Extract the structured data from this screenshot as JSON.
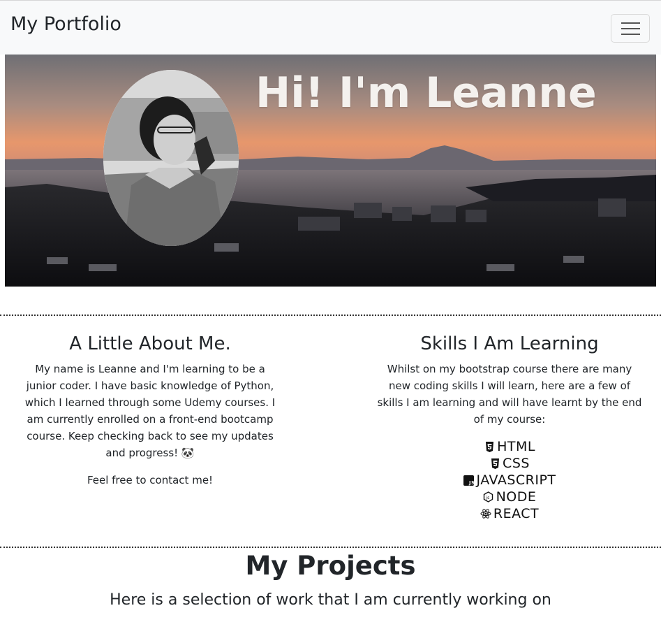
{
  "nav": {
    "brand": "My Portfolio",
    "toggler_icon": "hamburger-menu-icon"
  },
  "hero": {
    "title": "Hi! I'm Leanne",
    "avatar_icon": "profile-photo",
    "background": "sunset-coastline-photo"
  },
  "about": {
    "heading": "A Little About Me.",
    "body": "My name is Leanne and I'm learning to be a junior coder. I have basic knowledge of Python, which I learned through some Udemy courses. I am currently enrolled on a front-end bootcamp course. Keep checking back to see my updates and progress! 🐼",
    "contact": "Feel free to contact me!"
  },
  "skills": {
    "heading": "Skills I Am Learning",
    "body": "Whilst on my bootstrap course there are many new coding skills I will learn, here are a few of skills I am learning and will have learnt by the end of my course:",
    "items": [
      {
        "label": "HTML",
        "icon": "html5-icon"
      },
      {
        "label": "CSS",
        "icon": "css3-icon"
      },
      {
        "label": "JAVASCRIPT",
        "icon": "javascript-icon"
      },
      {
        "label": "NODE",
        "icon": "nodejs-icon"
      },
      {
        "label": "REACT",
        "icon": "react-icon"
      }
    ]
  },
  "projects": {
    "heading": "My Projects",
    "subheading": "Here is a selection of work that I am currently working on"
  }
}
